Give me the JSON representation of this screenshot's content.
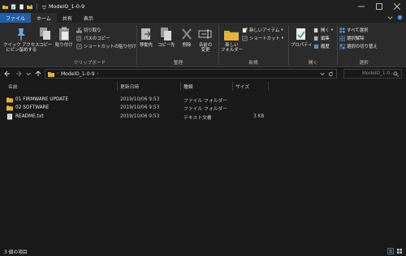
{
  "window": {
    "title": "ModelO_1-0-9",
    "controls": [
      "minimize",
      "maximize",
      "close"
    ]
  },
  "tabs": [
    {
      "label": "ファイル"
    },
    {
      "label": "ホーム"
    },
    {
      "label": "共有"
    },
    {
      "label": "表示"
    }
  ],
  "ribbon": {
    "groups": {
      "clipboard": "クリップボード",
      "organize": "整理",
      "new": "新規",
      "open": "開く",
      "select": "選択"
    },
    "buttons": {
      "quick_access": "クイック アクセス\nにピン留めする",
      "copy": "コピー",
      "paste": "貼り付け",
      "cut": "切り取り",
      "copy_path": "パスのコピー",
      "paste_shortcut": "ショートカットの貼り付け",
      "move_to": "移動先",
      "copy_to": "コピー先",
      "delete": "削除",
      "rename": "名前の\n変更",
      "new_folder": "新しい\nフォルダー",
      "new_item": "新しいアイテム",
      "shortcut": "ショートカット",
      "properties": "プロパティ",
      "open": "開く",
      "edit": "編集",
      "history": "履歴",
      "select_all": "すべて選択",
      "select_none": "選択解除",
      "invert_selection": "選択の切り替え"
    }
  },
  "address": {
    "path": "ModelO_1-0-9",
    "search_placeholder": "ModelO_1-0..."
  },
  "columns": {
    "name": "名前",
    "modified": "更新日時",
    "type": "種類",
    "size": "サイズ"
  },
  "files": [
    {
      "name": "01 FIRMWARE UPDATE",
      "modified": "2019/10/06 9:53",
      "type": "ファイル フォルダー",
      "size": "",
      "icon": "folder-icon"
    },
    {
      "name": "02 SOFTWARE",
      "modified": "2019/10/06 9:53",
      "type": "ファイル フォルダー",
      "size": "",
      "icon": "folder-icon"
    },
    {
      "name": "README.txt",
      "modified": "2019/10/06 9:53",
      "type": "テキスト文書",
      "size": "3 KB",
      "icon": "text-file-icon"
    }
  ],
  "status": {
    "count": "3 個の項目"
  },
  "colors": {
    "accent": "#1f5fa8",
    "folder": "#e8b437",
    "background": "#191919",
    "ribbon": "#2b2b2b"
  }
}
